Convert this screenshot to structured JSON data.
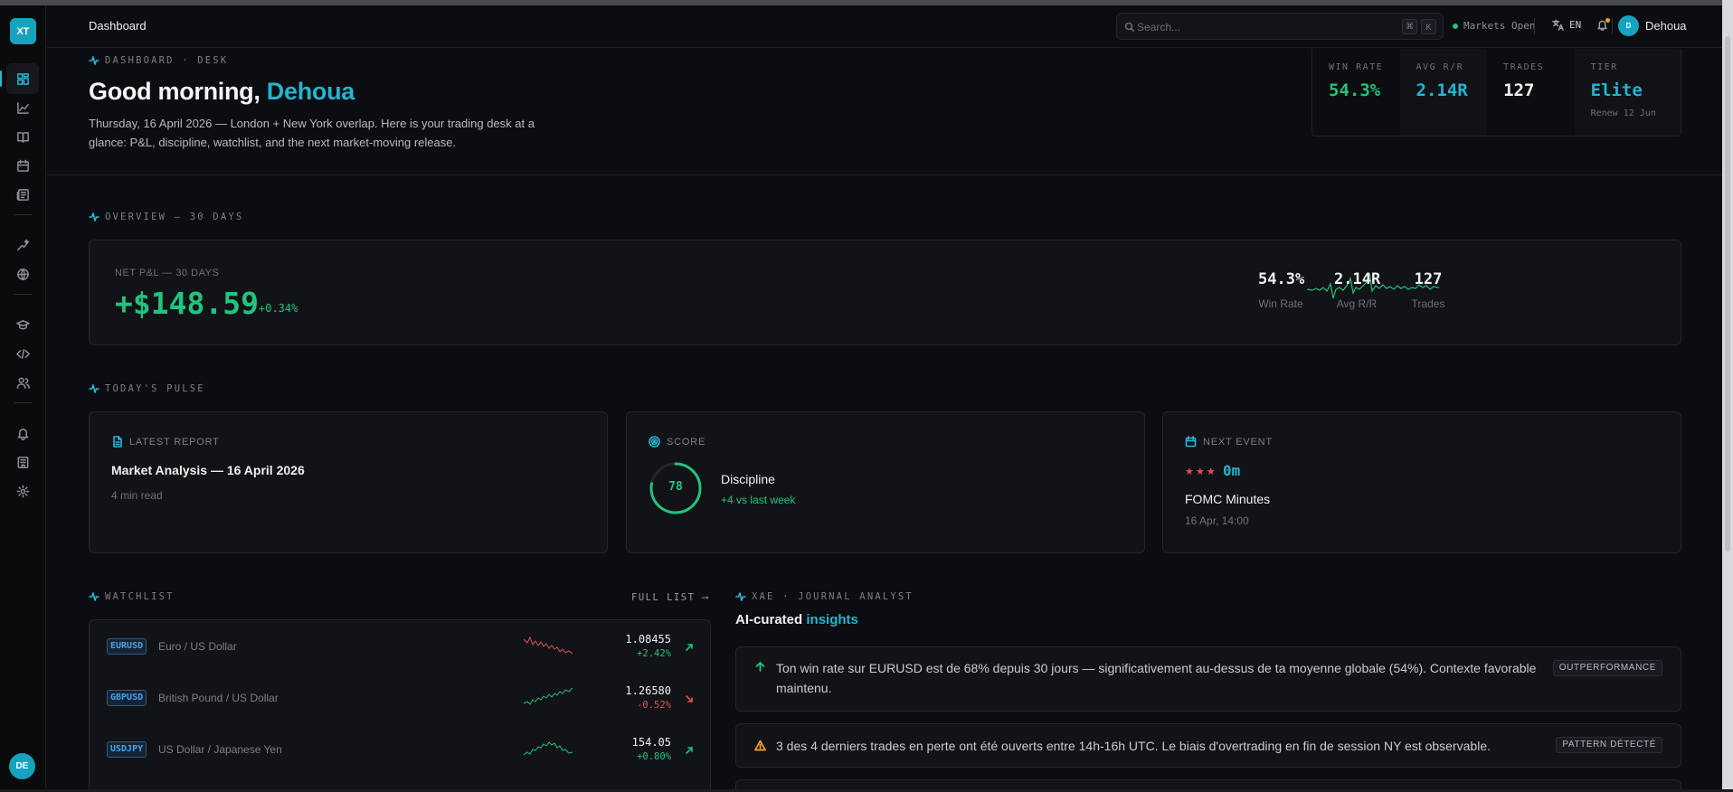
{
  "app": {
    "logo": "XT",
    "user_initials": "DE"
  },
  "header": {
    "title": "Dashboard",
    "search_placeholder": "Search...",
    "shortcut": [
      "⌘",
      "K"
    ],
    "market_status": "Markets Open",
    "language": "EN",
    "user_avatar": "D",
    "user_name": "Dehoua"
  },
  "sidebar": {
    "icons": [
      "dashboard-icon",
      "chart-icon",
      "journal-icon",
      "calendar-icon",
      "news-icon",
      "insights-icon",
      "globe-icon",
      "academy-icon",
      "code-icon",
      "community-icon",
      "bell-icon",
      "bank-icon",
      "gear-icon"
    ],
    "active": "dashboard-icon"
  },
  "hero": {
    "eyebrow": "DASHBOARD · DESK",
    "greeting": "Good morning,",
    "name": "Dehoua",
    "subtitle": "Thursday, 16 April 2026 — London + New York overlap. Here is your trading desk at a glance: P&L, discipline, watchlist, and the next market-moving release.",
    "kpis": [
      {
        "label": "WIN RATE",
        "value": "54.3%",
        "color": "#22c37e"
      },
      {
        "label": "AVG R/R",
        "value": "2.14R",
        "color": "#24b4d0"
      },
      {
        "label": "TRADES",
        "value": "127",
        "color": "#eef0f2"
      },
      {
        "label": "TIER",
        "value": "Elite",
        "sub": "Renew 12 Jun",
        "color": "#24b4d0"
      }
    ]
  },
  "overview": {
    "eyebrow": "OVERVIEW — 30 DAYS",
    "label": "NET P&L — 30 DAYS",
    "value": "+$148.59",
    "change": "+0.34%",
    "stats": [
      {
        "value": "54.3%",
        "label": "Win Rate"
      },
      {
        "value": "2.14R",
        "label": "Avg R/R"
      },
      {
        "value": "127",
        "label": "Trades"
      }
    ]
  },
  "pulse": {
    "eyebrow": "TODAY'S PULSE",
    "report": {
      "caption": "LATEST REPORT",
      "title": "Market Analysis — 16 April 2026",
      "meta": "4 min read"
    },
    "score": {
      "caption": "SCORE",
      "value": "78",
      "progress": 0.78,
      "label": "Discipline",
      "delta": "+4 vs last week"
    },
    "event": {
      "caption": "NEXT EVENT",
      "stars": "★★★",
      "countdown": "0m",
      "name": "FOMC Minutes",
      "time": "16 Apr, 14:00"
    }
  },
  "watchlist": {
    "eyebrow": "WATCHLIST",
    "full_list": "FULL LIST ⟶",
    "rows": [
      {
        "symbol": "EURUSD",
        "name": "Euro / US Dollar",
        "price": "1.08455",
        "change": "+2.42%",
        "dir": "up",
        "trend": "down"
      },
      {
        "symbol": "GBPUSD",
        "name": "British Pound / US Dollar",
        "price": "1.26580",
        "change": "-0.52%",
        "dir": "down",
        "trend": "up"
      },
      {
        "symbol": "USDJPY",
        "name": "US Dollar / Japanese Yen",
        "price": "154.05",
        "change": "+0.80%",
        "dir": "up",
        "trend": "hump"
      }
    ]
  },
  "insights": {
    "eyebrow": "XAE · JOURNAL ANALYST",
    "heading": "AI-curated",
    "heading_hl": "insights",
    "items": [
      {
        "icon": "arrow-up-icon",
        "text": "Ton win rate sur EURUSD est de 68% depuis 30 jours — significativement au-dessus de ta moyenne globale (54%). Contexte favorable maintenu.",
        "tag": "OUTPERFORMANCE"
      },
      {
        "icon": "warning-icon",
        "text": "3 des 4 derniers trades en perte ont été ouverts entre 14h-16h UTC. Le biais d'overtrading en fin de session NY est observable.",
        "tag": "PATTERN DÉTECTÉ"
      }
    ]
  },
  "colors": {
    "accent": "#24b4d0",
    "positive": "#22c37e",
    "negative": "#e05252",
    "background": "#0c0d10",
    "card": "#121317"
  }
}
